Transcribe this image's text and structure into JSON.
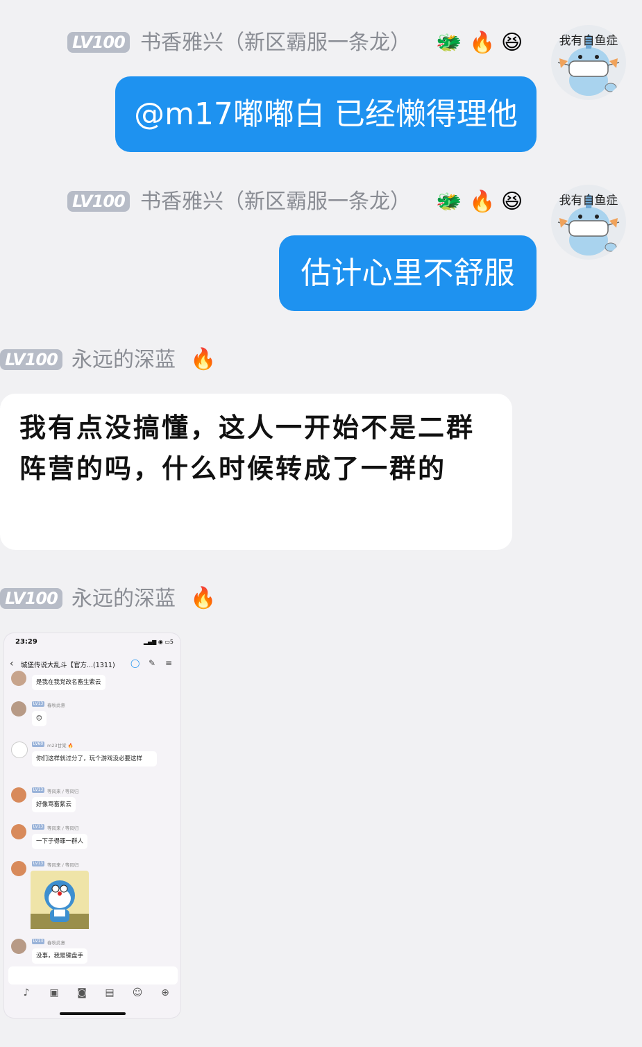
{
  "messages": [
    {
      "level": "LV100",
      "nickname": "书香雅兴（新区霸服一条龙）",
      "badges": [
        "🐲",
        "🔥",
        "😆"
      ],
      "avatar_caption": "我有自鱼症",
      "text": "@m17嘟嘟白 已经懒得理他"
    },
    {
      "level": "LV100",
      "nickname": "书香雅兴（新区霸服一条龙）",
      "badges": [
        "🐲",
        "🔥",
        "😆"
      ],
      "avatar_caption": "我有自鱼症",
      "text": "估计心里不舒服"
    },
    {
      "level": "LV100",
      "nickname": "永远的深蓝",
      "badges": [
        "🔥"
      ],
      "text": "我有点没搞懂，这人一开始不是二群阵营的吗，什么时候转成了一群的"
    },
    {
      "level": "LV100",
      "nickname": "永远的深蓝",
      "badges": [
        "🔥"
      ]
    }
  ],
  "screenshot": {
    "time": "23:29",
    "battery": "5",
    "title": "城堡传说大乱斗【官方...(1311)",
    "messages": [
      {
        "text": "是我在我党改名畜生紫云"
      },
      {
        "level": "LV13",
        "name": "春秋此意",
        "text": "😊"
      },
      {
        "level": "LV60",
        "name": "m23甘棠 🔥",
        "text": "你们这样就过分了，玩个游戏没必要这样"
      },
      {
        "level": "LV13",
        "name": "等风来 / 等风归",
        "text": "好像骂畜紫云"
      },
      {
        "level": "LV13",
        "name": "等风来 / 等风归",
        "text": "一下子得罪一群人"
      },
      {
        "level": "LV13",
        "name": "等风来 / 等风归",
        "sticker": "doraemon-sticker"
      },
      {
        "level": "LV13",
        "name": "春秋此意",
        "text": "没事，我是键盘手"
      }
    ]
  },
  "colors": {
    "background": "#f1f1f3",
    "self_bubble": "#1e92f0",
    "level_badge": "#b7bcc7",
    "nickname": "#8a8d94"
  }
}
